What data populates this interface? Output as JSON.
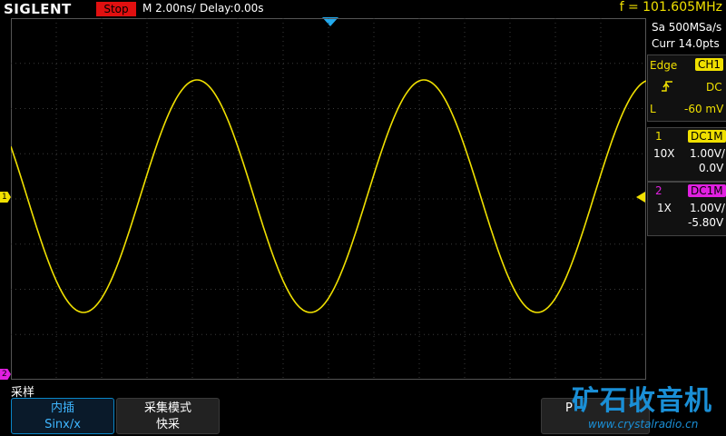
{
  "header": {
    "logo": "SIGLENT",
    "run_state": "Stop",
    "timebase": "M 2.00ns/",
    "delay": "Delay:0.00s",
    "frequency": "f = 101.605MHz"
  },
  "acquisition": {
    "sample_rate": "Sa 500MSa/s",
    "memory": "Curr 14.0pts"
  },
  "trigger": {
    "type": "Edge",
    "source": "CH1",
    "slope_icon": "rising-edge-icon",
    "coupling": "DC",
    "level_label": "L",
    "level": "-60 mV"
  },
  "channels": [
    {
      "number": "1",
      "coupling": "DC1M",
      "probe": "10X",
      "scale": "1.00V/",
      "offset": "0.0V",
      "color": "#f0e000"
    },
    {
      "number": "2",
      "coupling": "DC1M",
      "probe": "1X",
      "scale": "1.00V/",
      "offset": "-5.80V",
      "color": "#e020e0"
    }
  ],
  "markers": {
    "ch1": "1",
    "ch2": "2"
  },
  "menu": {
    "title": "采样",
    "softkeys": [
      {
        "line1": "内插",
        "line2": "Sinx/x"
      },
      {
        "line1": "采集模式",
        "line2": "快采"
      },
      {
        "line1": "",
        "line2": "P"
      }
    ]
  },
  "watermark": {
    "text": "矿石收音机",
    "url": "www.crystalradio.cn"
  },
  "colors": {
    "ch1": "#f0e000",
    "ch2": "#e020e0",
    "stop": "#e01010",
    "accent": "#0a86c8"
  }
}
